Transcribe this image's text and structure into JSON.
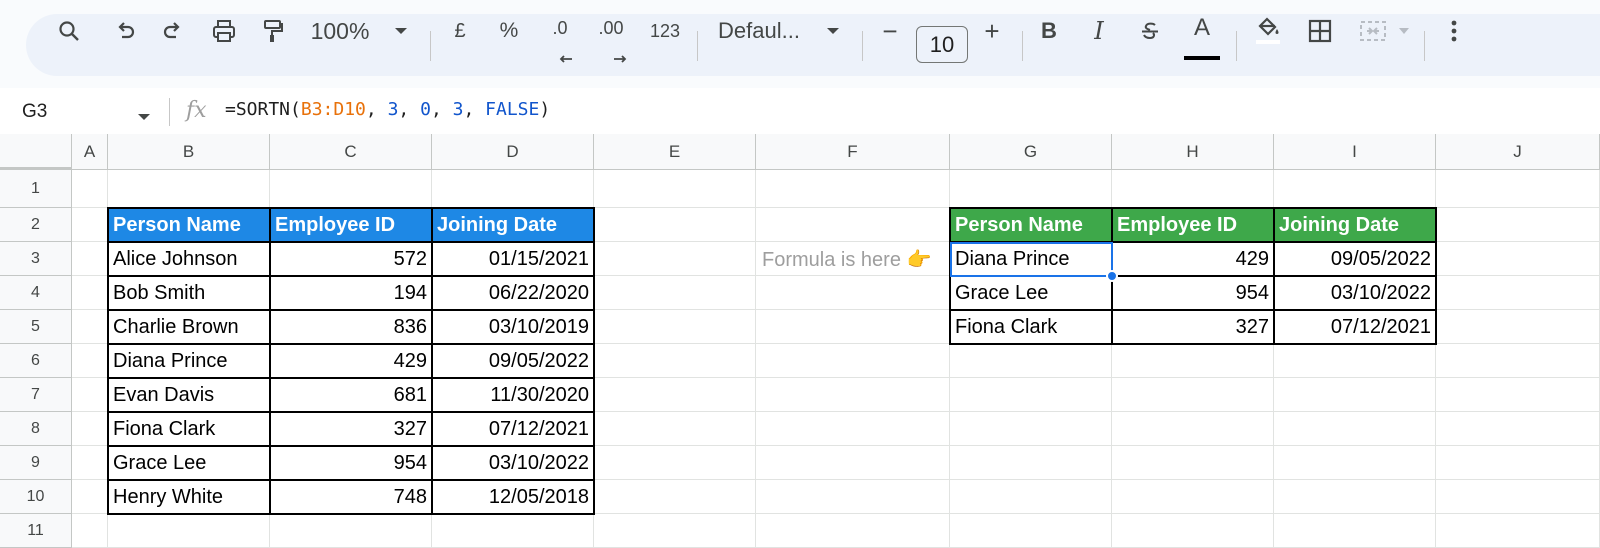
{
  "toolbar": {
    "zoom": "100%",
    "currency": "£",
    "percent": "%",
    "dec_decrease": ".0",
    "dec_increase": ".00",
    "number_format": "123",
    "font": "Defaul...",
    "font_size": "10",
    "minus": "−",
    "plus": "+",
    "bold": "B",
    "italic": "I",
    "text_color_letter": "A",
    "text_color": "#000000",
    "fill_color": "#ffffff",
    "icons": [
      "search-icon",
      "undo-icon",
      "redo-icon",
      "print-icon",
      "paint-format-icon",
      "zoom-dropdown-icon",
      "font-dropdown-icon",
      "strikethrough-icon",
      "text-color-icon",
      "fill-color-icon",
      "borders-icon",
      "merge-cells-icon",
      "more-icon"
    ]
  },
  "formula_bar": {
    "cell_ref": "G3",
    "fx": "fx",
    "formula_parts": [
      {
        "text": "=SORTN(",
        "kind": "plain"
      },
      {
        "text": "B3:D10",
        "kind": "range"
      },
      {
        "text": ", ",
        "kind": "plain"
      },
      {
        "text": "3",
        "kind": "num"
      },
      {
        "text": ", ",
        "kind": "plain"
      },
      {
        "text": "0",
        "kind": "num"
      },
      {
        "text": ", ",
        "kind": "plain"
      },
      {
        "text": "3",
        "kind": "num"
      },
      {
        "text": ", ",
        "kind": "plain"
      },
      {
        "text": "FALSE",
        "kind": "num"
      },
      {
        "text": ")",
        "kind": "plain"
      }
    ]
  },
  "sheet": {
    "columns": [
      "A",
      "B",
      "C",
      "D",
      "E",
      "F",
      "G",
      "H",
      "I",
      "J"
    ],
    "rows": [
      "1",
      "2",
      "3",
      "4",
      "5",
      "6",
      "7",
      "8",
      "9",
      "10",
      "11"
    ],
    "colors": {
      "header_blue": "#1e88e5",
      "header_green": "#3ea84a",
      "selection": "#1a73e8"
    },
    "source_table": {
      "headers": [
        "Person Name",
        "Employee ID",
        "Joining Date"
      ],
      "rows": [
        [
          "Alice Johnson",
          "572",
          "01/15/2021"
        ],
        [
          "Bob Smith",
          "194",
          "06/22/2020"
        ],
        [
          "Charlie Brown",
          "836",
          "03/10/2019"
        ],
        [
          "Diana Prince",
          "429",
          "09/05/2022"
        ],
        [
          "Evan Davis",
          "681",
          "11/30/2020"
        ],
        [
          "Fiona Clark",
          "327",
          "07/12/2021"
        ],
        [
          "Grace Lee",
          "954",
          "03/10/2022"
        ],
        [
          "Henry White",
          "748",
          "12/05/2018"
        ]
      ]
    },
    "note": "Formula is here 👉",
    "result_table": {
      "headers": [
        "Person Name",
        "Employee ID",
        "Joining Date"
      ],
      "rows": [
        [
          "Diana Prince",
          "429",
          "09/05/2022"
        ],
        [
          "Grace Lee",
          "954",
          "03/10/2022"
        ],
        [
          "Fiona Clark",
          "327",
          "07/12/2021"
        ]
      ]
    }
  }
}
